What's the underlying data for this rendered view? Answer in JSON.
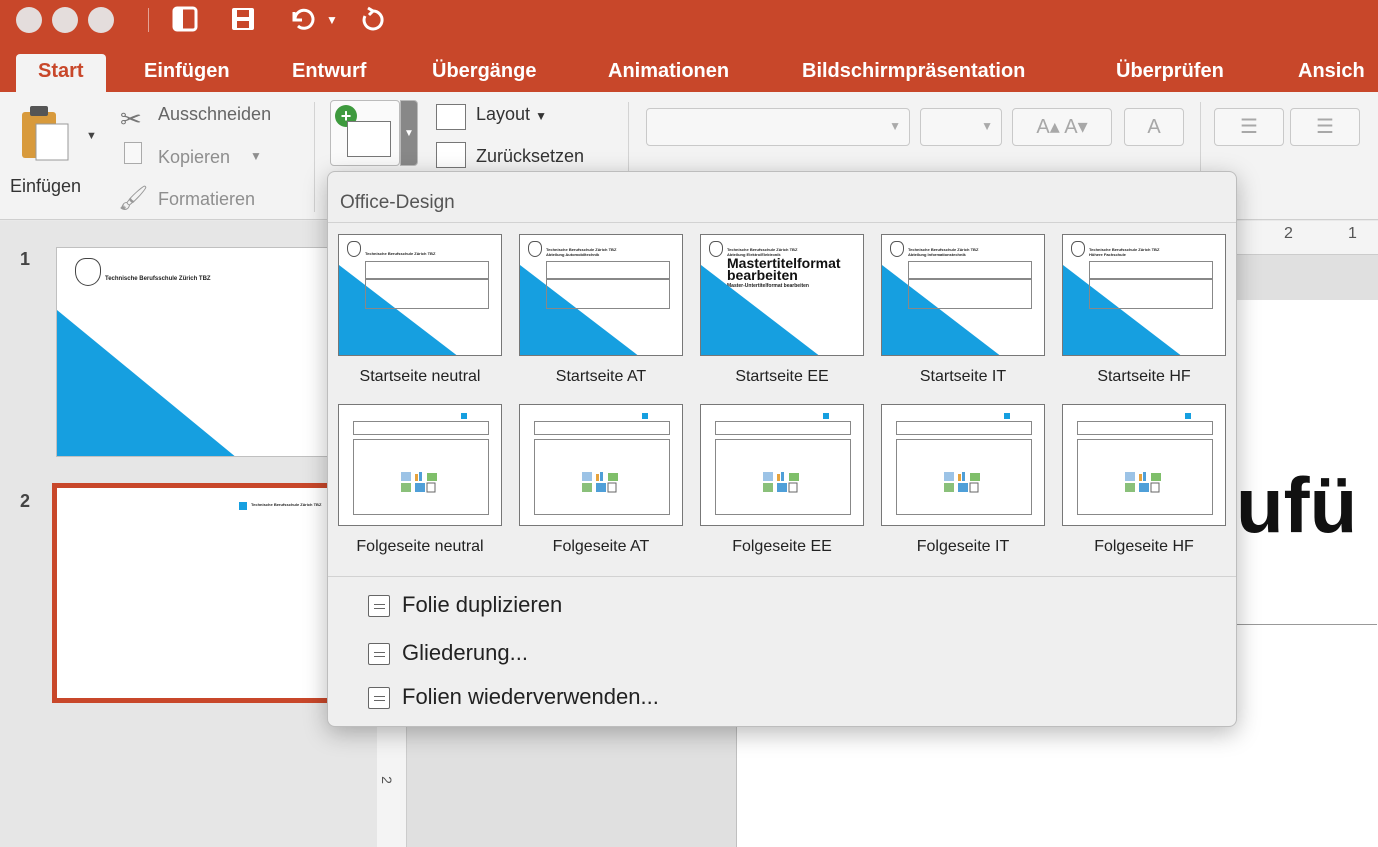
{
  "tabs": [
    {
      "label": "Start",
      "active": true
    },
    {
      "label": "Einfügen"
    },
    {
      "label": "Entwurf"
    },
    {
      "label": "Übergänge"
    },
    {
      "label": "Animationen"
    },
    {
      "label": "Bildschirmpräsentation"
    },
    {
      "label": "Überprüfen"
    },
    {
      "label": "Ansich"
    }
  ],
  "ribbon": {
    "paste_label": "Einfügen",
    "cut_label": "Ausschneiden",
    "copy_label": "Kopieren",
    "format_label": "Formatieren",
    "layout_label": "Layout",
    "reset_label": "Zurücksetzen"
  },
  "slides": [
    {
      "number": "1",
      "logo_text": "Technische Berufsschule Zürich TBZ"
    },
    {
      "number": "2",
      "logo_text": "Technische Berufsschule Zürich TBZ"
    }
  ],
  "gallery": {
    "title": "Office-Design",
    "layouts": [
      {
        "name": "Startseite neutral",
        "header": "Technische Berufsschule Zürich TBZ",
        "sub": ""
      },
      {
        "name": "Startseite AT",
        "header": "Technische Berufsschule Zürich TBZ",
        "sub": "Abteilung Automobiltechnik"
      },
      {
        "name": "Startseite EE",
        "header": "Technische Berufsschule Zürich TBZ",
        "sub": "Abteilung Elektro/Elektronik",
        "title": "Mastertitelformat bearbeiten",
        "subtitle": "Master-Untertitelformat bearbeiten"
      },
      {
        "name": "Startseite IT",
        "header": "Technische Berufsschule Zürich TBZ",
        "sub": "Abteilung Informationstechnik"
      },
      {
        "name": "Startseite HF",
        "header": "Technische Berufsschule Zürich TBZ",
        "sub": "Höhere Fachschule"
      },
      {
        "name": "Folgeseite neutral"
      },
      {
        "name": "Folgeseite AT"
      },
      {
        "name": "Folgeseite EE"
      },
      {
        "name": "Folgeseite IT"
      },
      {
        "name": "Folgeseite HF"
      }
    ],
    "actions": [
      {
        "label": "Folie duplizieren"
      },
      {
        "label": "Gliederung..."
      },
      {
        "label": "Folien wiederverwenden..."
      }
    ]
  },
  "workarea": {
    "big_text": "ufü",
    "ruler_ticks": [
      "2",
      "1"
    ],
    "vruler_tick": "2"
  },
  "colors": {
    "accent": "#c8472a",
    "slide_blue": "#169fe0"
  }
}
